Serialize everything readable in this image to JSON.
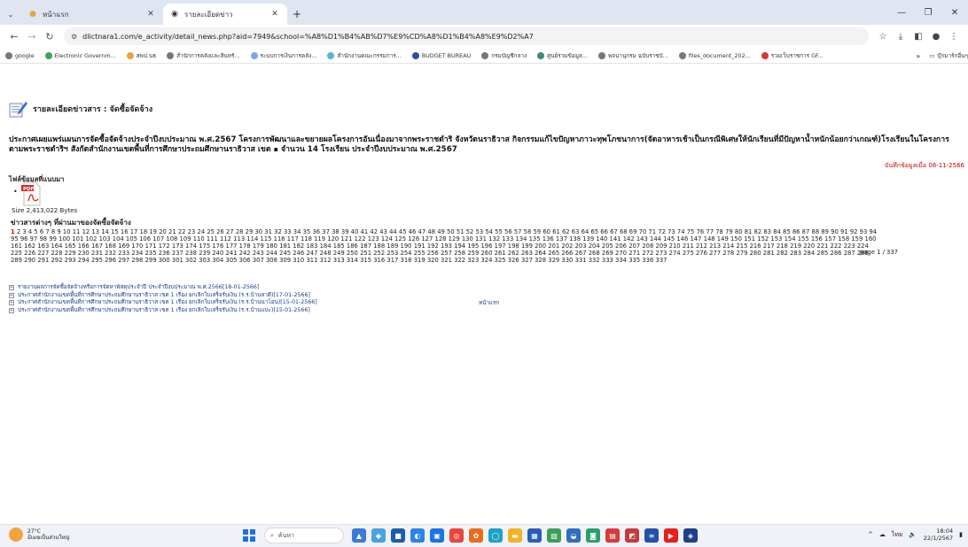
{
  "tabs": {
    "inactive": {
      "title": "หน้าแรก"
    },
    "active": {
      "title": "รายละเอียดข่าว"
    }
  },
  "toolbar": {
    "url": "dlictnara1.com/e_activity/detail_news.php?aid=7949&school=%A8%D1%B4%AB%D7%E9%CD%A8%D1%B4%A8%E9%D2%A7"
  },
  "bookmarks": {
    "items": [
      "google",
      "Electronic Governm...",
      "สพป.นธ",
      "สำนักการคลังและสินทรั...",
      "ระบบการเงินการคลัง...",
      "สำนักงานคณะกรรมการ...",
      "BUDGET BUREAU",
      "กรมบัญชีกลาง",
      "ศูนย์รวมข้อมูล...",
      "พจนานุกรม ฉบับราชบั...",
      "files_document_202...",
      "รวมเว็บราชการ GF..."
    ],
    "more": "»",
    "folder": "บุ๊กมาร์กอื่นๆ"
  },
  "page": {
    "header": "รายละเอียดข่าวสาร : จัดซื้อจัดจ้าง",
    "announcement": "ประกาศเผยแพร่แผนการจัดซื้อจัดจ้างประจำปีงบประมาณ พ.ศ.2567 โครงการพัฒนาและขยายผลโครงการอันเนื่องมาจากพระราชดำริ จังหวัดนราธิวาส กิจกรรมแก้ไขปัญหาภาวะทุพโภชนาการ(จัดอาหารเช้าเป็นกรณีพิเศษให้นักเรียนที่มีปัญหาน้ำหนักน้อยกว่าเกณฑ์)โรงเรียนในโครงการตามพระราชดำริฯ สังกัดสำนักงานเขตพื้นที่การศึกษาประถมศึกษานราธิวาส เขต ๑ จำนวน 14 โรงเรียน ประจำปีงบประมาณ พ.ศ.2567",
    "record_date": "บันทึกข้อมูลเมื่อ 08-11-2566",
    "attachments_title": "ไฟล์ข้อมูลที่แนบมา",
    "bullet": "•",
    "file_size": "Size 2,413,022 Bytes",
    "news_title": "ข่าวสารต่างๆ ที่ผ่านมาของจัดซื้อจัดจ้าง",
    "current_page": "1",
    "total_pages": 337,
    "page_indicator": "page 1 / 337",
    "news_list": [
      "รายงานผลการจัดซื้อจัดจ้างหรือการจัดหาพัสดุประจำปี ประจำปีงบประมาณ พ.ศ.2566[18-01-2566]",
      "ประกาศสำนักงานเขตพื้นที่การศึกษาประถมศึกษานราธิวาส เขต 1 เรื่อง ยกเลิกใบเสร็จรับเงิน (ร.ร.บ้านลาดี)[17-01-2566]",
      "ประกาศสำนักงานเขตพื้นที่การศึกษาประถมศึกษานราธิวาส เขต 1 เรื่อง ยกเลิกใบเสร็จรับเงิน (ร.ร.บ้านนาโอน)[15-01-2566]",
      "ประกาศสำนักงานเขตพื้นที่การศึกษาประถมศึกษานราธิวาส เขต 1 เรื่อง ยกเลิกใบเสร็จรับเงิน (ร.ร.บ้านแปะ)[15-01-2566]"
    ],
    "home_link": "หน้าแรก"
  },
  "taskbar": {
    "weather_temp": "27°C",
    "weather_desc": "มีเมฆเป็นส่วนใหญ่",
    "search_placeholder": "ค้นหา",
    "lang": "ไทย",
    "time": "18:04",
    "date": "22/1/2567"
  },
  "colors": {
    "accent": "#1a73e8",
    "link": "#1a3c8c",
    "current_page": "#dd0000"
  }
}
